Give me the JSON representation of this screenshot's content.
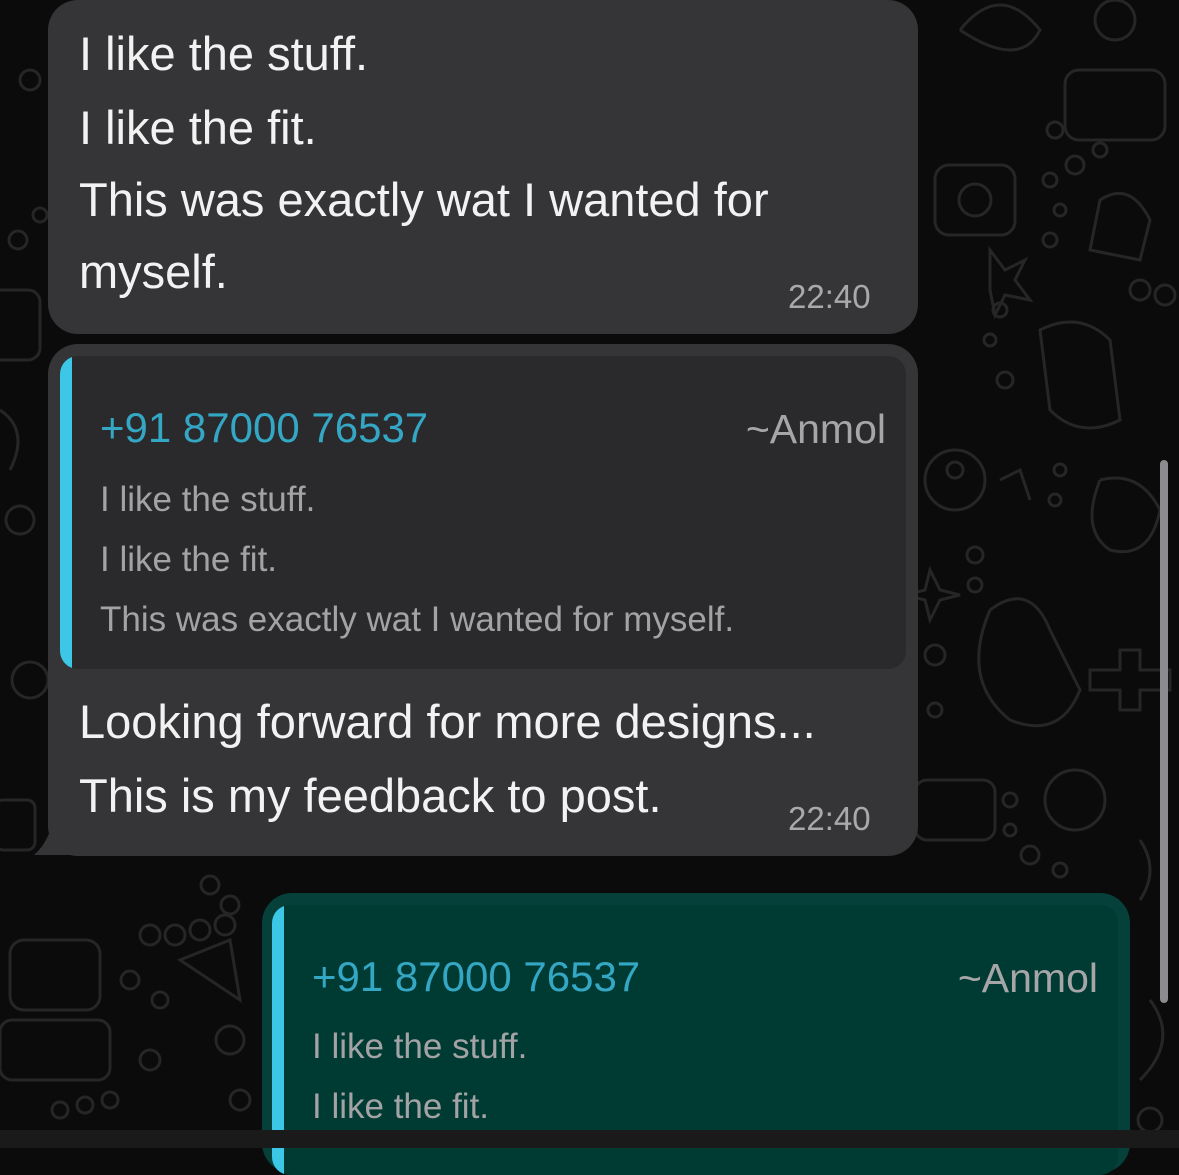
{
  "colors": {
    "background": "#0b0b0b",
    "incoming_bubble": "#353437",
    "outgoing_bubble": "#05403a",
    "quote_bar": "#3cc7e6",
    "quote_sender": "#34a7c4"
  },
  "messages": [
    {
      "direction": "incoming",
      "lines": [
        "I like the stuff.",
        "I like the fit.",
        "This was exactly wat I wanted for",
        "myself."
      ],
      "time": "22:40"
    },
    {
      "direction": "incoming",
      "quote": {
        "sender": "+91 87000 76537",
        "alias": "~Anmol",
        "lines": [
          "I like the stuff.",
          "I like the fit.",
          "This was exactly wat I wanted for myself."
        ]
      },
      "lines": [
        "Looking forward for more designs...",
        "This is my feedback to post."
      ],
      "time": "22:40"
    },
    {
      "direction": "outgoing",
      "quote": {
        "sender": "+91 87000 76537",
        "alias": "~Anmol",
        "lines": [
          "I like the stuff.",
          "I like the fit."
        ]
      }
    }
  ]
}
